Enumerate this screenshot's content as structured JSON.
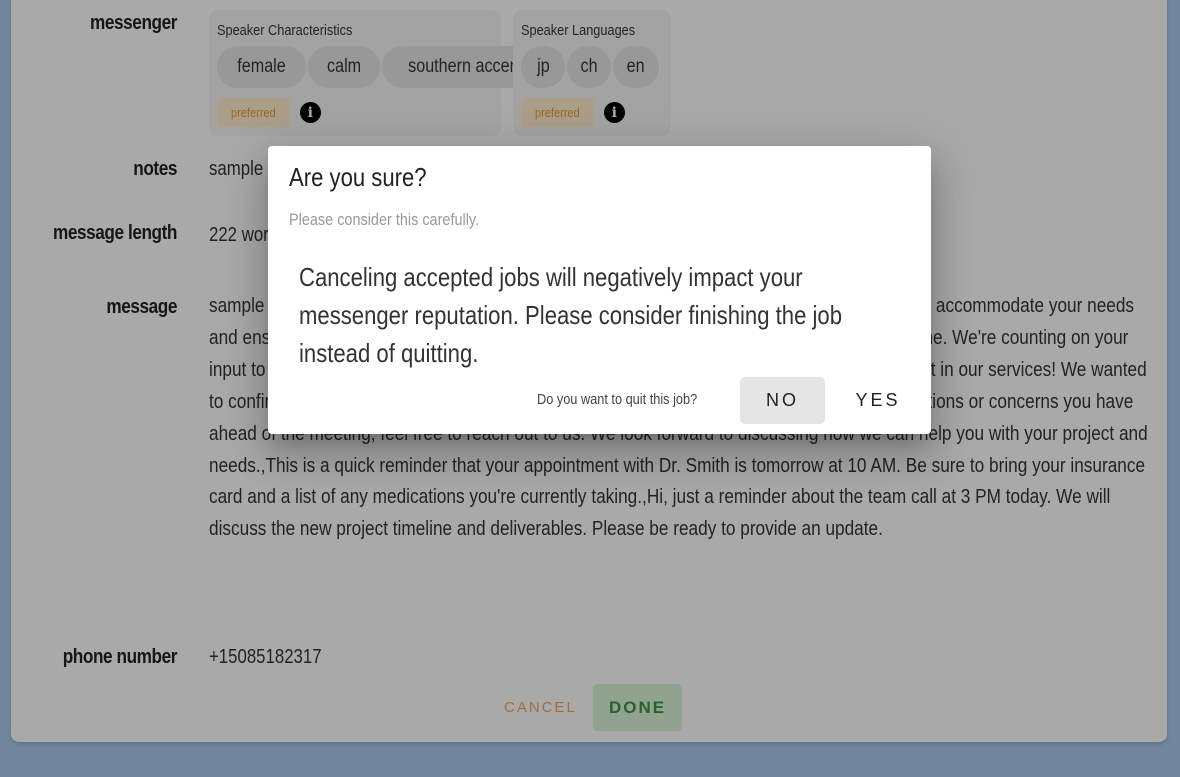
{
  "form": {
    "messenger": {
      "label": "messenger",
      "characteristics": {
        "title": "Speaker Characteristics",
        "chips": [
          "female",
          "calm",
          "southern accent"
        ],
        "badge": "preferred"
      },
      "languages": {
        "title": "Speaker Languages",
        "chips": [
          "jp",
          "ch",
          "en"
        ],
        "badge": "preferred"
      }
    },
    "notes": {
      "label": "notes",
      "value": "sample notes"
    },
    "message_length": {
      "label": "message length",
      "value": "222 words"
    },
    "message": {
      "label": "message",
      "value": "sample message ... between 2 and 4 PM. If there are any issues with the ... we'll do our best to accommodate your needs and ensure a ... Please make sure to submit your final ... next steps, don't hesitate to contact me. We're counting on your input to ensure everything goes smoothly for the project completion.,Thank you for your interest in our services! We wanted to confirm that your consultation is set for next Monday at 11 AM. If there are any specific questions or concerns you have ahead of the meeting, feel free to reach out to us. We look forward to discussing how we can help you with your project and needs.,This is a quick reminder that your appointment with Dr. Smith is tomorrow at 10 AM. Be sure to bring your insurance card and a list of any medications you're currently taking.,Hi, just a reminder about the team call at 3 PM today. We will discuss the new project timeline and deliverables. Please be ready to provide an update."
    },
    "phone_number": {
      "label": "phone number",
      "value": "+15085182317"
    },
    "actions": {
      "cancel": "CANCEL",
      "done": "DONE"
    }
  },
  "dialog": {
    "title": "Are you sure?",
    "subtitle": "Please consider this carefully.",
    "body": "Canceling accepted jobs will negatively impact your messenger reputation. Please consider finishing the job instead of quitting.",
    "question": "Do you want to quit this job?",
    "no": "NO",
    "yes": "YES"
  },
  "icons": {
    "info": "info-icon"
  },
  "colors": {
    "page_bg": "#a7c5e6",
    "badge_text": "#e39a2e",
    "badge_bg": "#fde9c9",
    "done_text": "#3e8e46",
    "done_bg": "#d4f0d2",
    "cancel_text": "#f0a25a"
  }
}
